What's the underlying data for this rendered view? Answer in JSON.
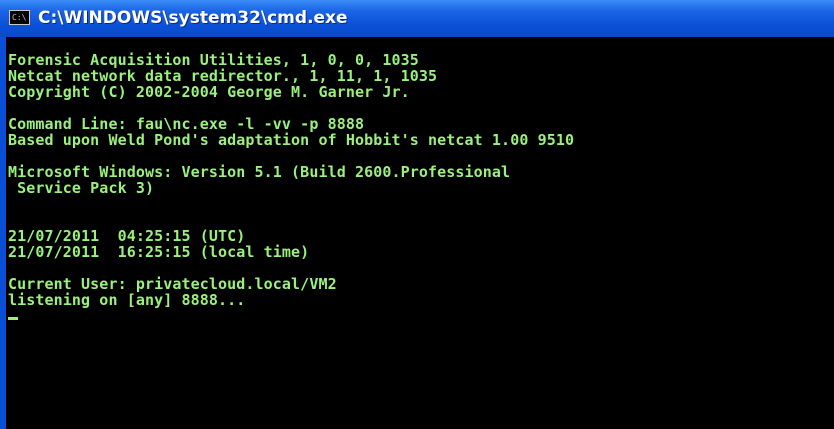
{
  "window": {
    "title": "C:\\WINDOWS\\system32\\cmd.exe",
    "icon_label": "C:\\",
    "icon": "console-icon"
  },
  "console": {
    "lines": [
      "Forensic Acquisition Utilities, 1, 0, 0, 1035",
      "Netcat network data redirector., 1, 11, 1, 1035",
      "Copyright (C) 2002-2004 George M. Garner Jr.",
      "",
      "Command Line: fau\\nc.exe -l -vv -p 8888",
      "Based upon Weld Pond's adaptation of Hobbit's netcat 1.00 9510",
      "",
      "Microsoft Windows: Version 5.1 (Build 2600.Professional",
      " Service Pack 3)",
      "",
      "",
      "21/07/2011  04:25:15 (UTC)",
      "21/07/2011  16:25:15 (local time)",
      "",
      "Current User: privatecloud.local/VM2",
      "listening on [any] 8888..."
    ],
    "text_color": "#9af27c",
    "background_color": "#000000"
  }
}
